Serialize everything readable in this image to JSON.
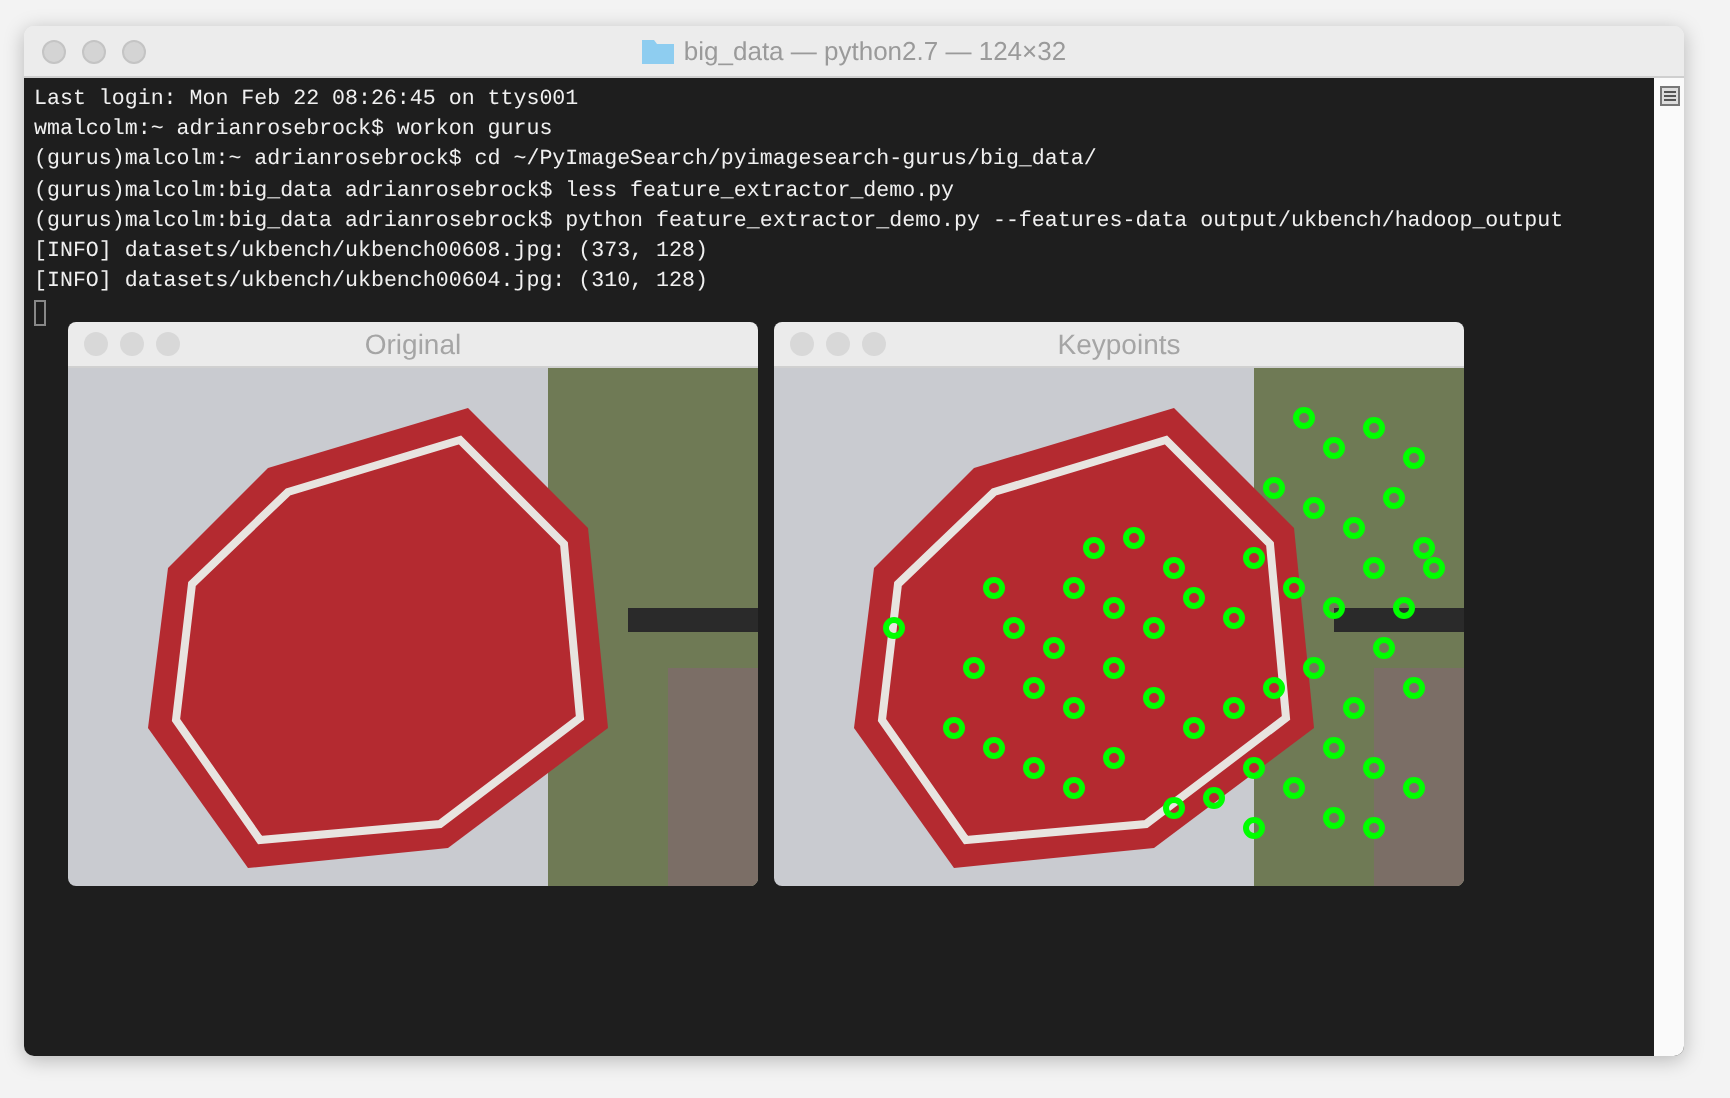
{
  "window": {
    "title": "big_data — python2.7 — 124×32"
  },
  "terminal_lines": [
    "Last login: Mon Feb 22 08:26:45 on ttys001",
    "wmalcolm:~ adrianrosebrock$ workon gurus",
    "(gurus)malcolm:~ adrianrosebrock$ cd ~/PyImageSearch/pyimagesearch-gurus/big_data/",
    "(gurus)malcolm:big_data adrianrosebrock$ less feature_extractor_demo.py",
    "(gurus)malcolm:big_data adrianrosebrock$ python feature_extractor_demo.py --features-data output/ukbench/hadoop_output",
    "[INFO] datasets/ukbench/ukbench00608.jpg: (373, 128)",
    "[INFO] datasets/ukbench/ukbench00604.jpg: (310, 128)"
  ],
  "image_windows": [
    {
      "title": "Original",
      "kind": "photo"
    },
    {
      "title": "Keypoints",
      "kind": "keypoints"
    }
  ]
}
